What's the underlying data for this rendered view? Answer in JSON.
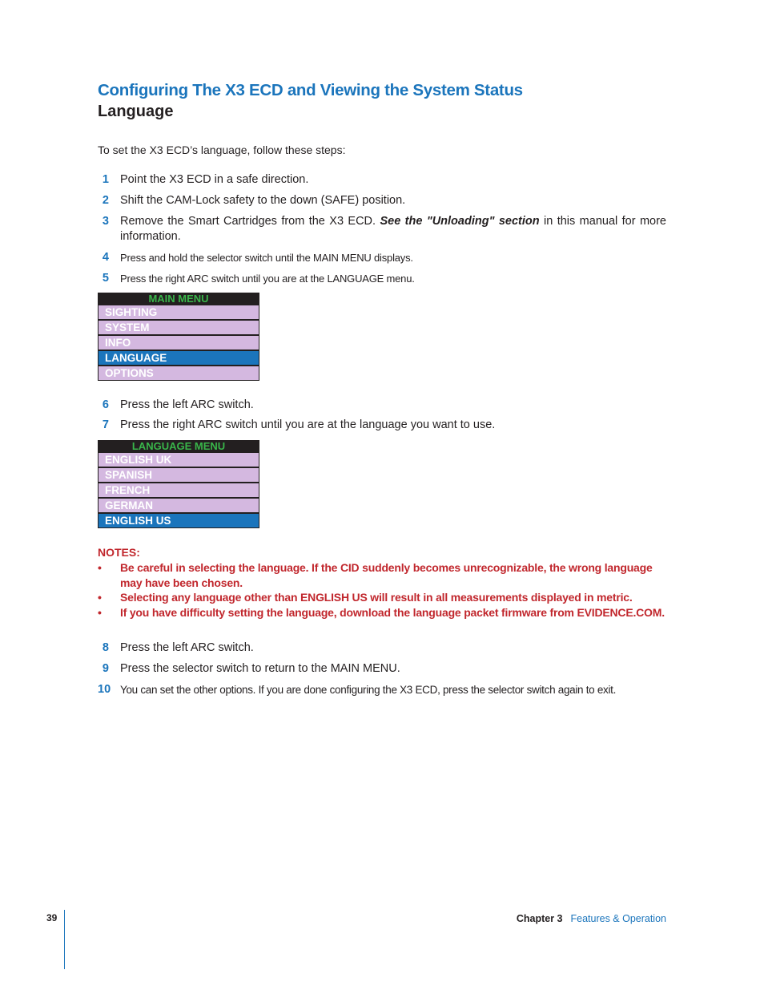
{
  "header": {
    "title": "Configuring The X3 ECD and Viewing the System Status",
    "subtitle": "Language"
  },
  "intro": "To set the X3 ECD’s language, follow these steps:",
  "steps_a": [
    {
      "num": "1",
      "text": "Point the X3 ECD in a safe direction."
    },
    {
      "num": "2",
      "text": "Shift the CAM-Lock safety to the down (SAFE) position."
    },
    {
      "num": "3",
      "text_before": "Remove the Smart Cartridges from the X3 ECD.",
      "emphasis": "See the \"Unloading\" section",
      "text_after": "in this manual for more information."
    },
    {
      "num": "4",
      "text": "Press and hold the selector switch until the MAIN MENU displays."
    },
    {
      "num": "5",
      "text": "Press the right ARC switch until you are at the LANGUAGE menu."
    }
  ],
  "main_menu": {
    "title": "MAIN MENU",
    "items": [
      "SIGHTING",
      "SYSTEM",
      "INFO",
      "LANGUAGE",
      "OPTIONS"
    ],
    "selected": "LANGUAGE"
  },
  "steps_b": [
    {
      "num": "6",
      "text": "Press the left ARC switch."
    },
    {
      "num": "7",
      "text": "Press the right ARC switch until you are at the language you want to use."
    }
  ],
  "language_menu": {
    "title": "LANGUAGE MENU",
    "items": [
      "ENGLISH UK",
      "SPANISH",
      "FRENCH",
      "GERMAN",
      "ENGLISH US"
    ],
    "selected": "ENGLISH US"
  },
  "notes": {
    "title": "NOTES:",
    "bullet": "•",
    "items": [
      "Be careful in selecting the language. If the CID suddenly becomes unrecognizable, the wrong language may have been chosen.",
      "Selecting any language other than ENGLISH US will result in all measurements displayed in metric.",
      "If you have difficulty setting the language, download the language packet firmware from EVIDENCE.COM."
    ]
  },
  "steps_c": [
    {
      "num": "8",
      "text": "Press the left ARC switch."
    },
    {
      "num": "9",
      "text": "Press the selector switch to return to the MAIN MENU."
    },
    {
      "num": "10",
      "text": "You can set the other options. If you are done configuring the X3 ECD, press the selector switch again to exit."
    }
  ],
  "footer": {
    "page_number": "39",
    "chapter": "Chapter 3",
    "section": "Features & Operation"
  },
  "colors": {
    "accent_blue": "#1b75bc",
    "note_red": "#c1272d",
    "menu_green": "#39b54a",
    "menu_item_bg": "#d4b8e0"
  }
}
